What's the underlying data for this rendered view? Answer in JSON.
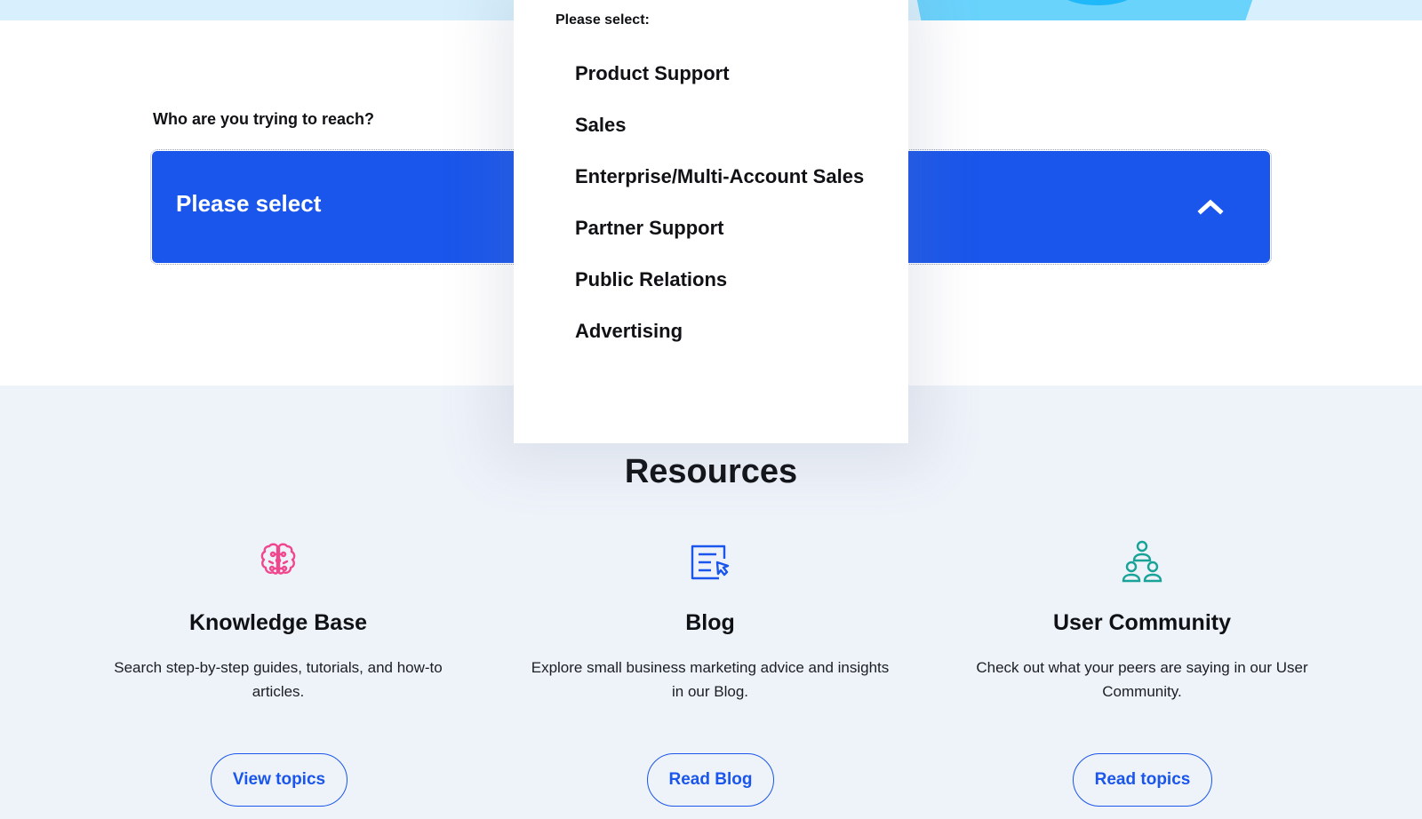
{
  "contact": {
    "label": "Who are you trying to reach?",
    "select": {
      "value": "Please select",
      "expanded": true,
      "icon": "chevron-up-icon"
    },
    "dropdown": {
      "header": "Please select:",
      "options": [
        "Product Support",
        "Sales",
        "Enterprise/Multi-Account Sales",
        "Partner Support",
        "Public Relations",
        "Advertising"
      ]
    }
  },
  "resources": {
    "title": "Resources",
    "items": [
      {
        "icon": "brain-icon",
        "title": "Knowledge Base",
        "description": "Search step-by-step guides, tutorials, and how-to articles.",
        "button": "View topics",
        "icon_color": "#f0468e"
      },
      {
        "icon": "blog-document-cursor-icon",
        "title": "Blog",
        "description": "Explore small business marketing advice and insights in our Blog.",
        "button": "Read Blog",
        "icon_color": "#1a56eb"
      },
      {
        "icon": "people-group-icon",
        "title": "User Community",
        "description": "Check out what your peers are saying in our User Community.",
        "button": "Read topics",
        "icon_color": "#17a398"
      }
    ]
  },
  "colors": {
    "accent": "#1a56eb",
    "top_band": "#d8f0fd",
    "resources_bg": "#eef2f9"
  }
}
